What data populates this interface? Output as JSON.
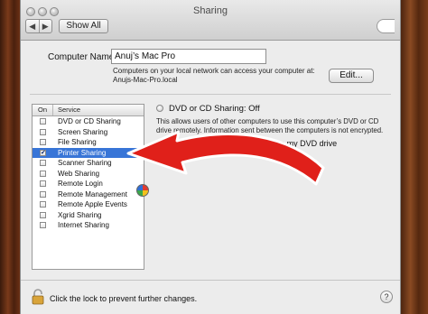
{
  "window": {
    "title": "Sharing",
    "nav_back": "◀",
    "nav_forward": "▶",
    "show_all": "Show All"
  },
  "computer_name": {
    "label": "Computer Name:",
    "value": "Anuj’s Mac Pro",
    "description_line1": "Computers on your local network can access your computer at:",
    "description_line2": "Anujs-Mac-Pro.local",
    "edit_button": "Edit..."
  },
  "services": {
    "header_on": "On",
    "header_service": "Service",
    "items": [
      {
        "label": "DVD or CD Sharing",
        "checked": false,
        "selected": false
      },
      {
        "label": "Screen Sharing",
        "checked": false,
        "selected": false
      },
      {
        "label": "File Sharing",
        "checked": false,
        "selected": false
      },
      {
        "label": "Printer Sharing",
        "checked": true,
        "selected": true
      },
      {
        "label": "Scanner Sharing",
        "checked": false,
        "selected": false
      },
      {
        "label": "Web Sharing",
        "checked": false,
        "selected": false
      },
      {
        "label": "Remote Login",
        "checked": false,
        "selected": false
      },
      {
        "label": "Remote Management",
        "checked": false,
        "selected": false
      },
      {
        "label": "Remote Apple Events",
        "checked": false,
        "selected": false
      },
      {
        "label": "Xgrid Sharing",
        "checked": false,
        "selected": false
      },
      {
        "label": "Internet Sharing",
        "checked": false,
        "selected": false
      }
    ]
  },
  "detail": {
    "status": "DVD or CD Sharing: Off",
    "description_line1": "This allows users of other computers to use this computer’s DVD or CD",
    "description_line2": "drive remotely. Information sent between the computers is not encrypted.",
    "ask_option": "me before allowing others to use my DVD drive"
  },
  "footer": {
    "lock_text": "Click the lock to prevent further changes.",
    "help": "?"
  },
  "colors": {
    "selection": "#3875d7",
    "arrow": "#e0201a"
  },
  "icons": [
    "lock-icon",
    "help-icon",
    "printer-ball-icon",
    "red-arrow-annotation"
  ]
}
